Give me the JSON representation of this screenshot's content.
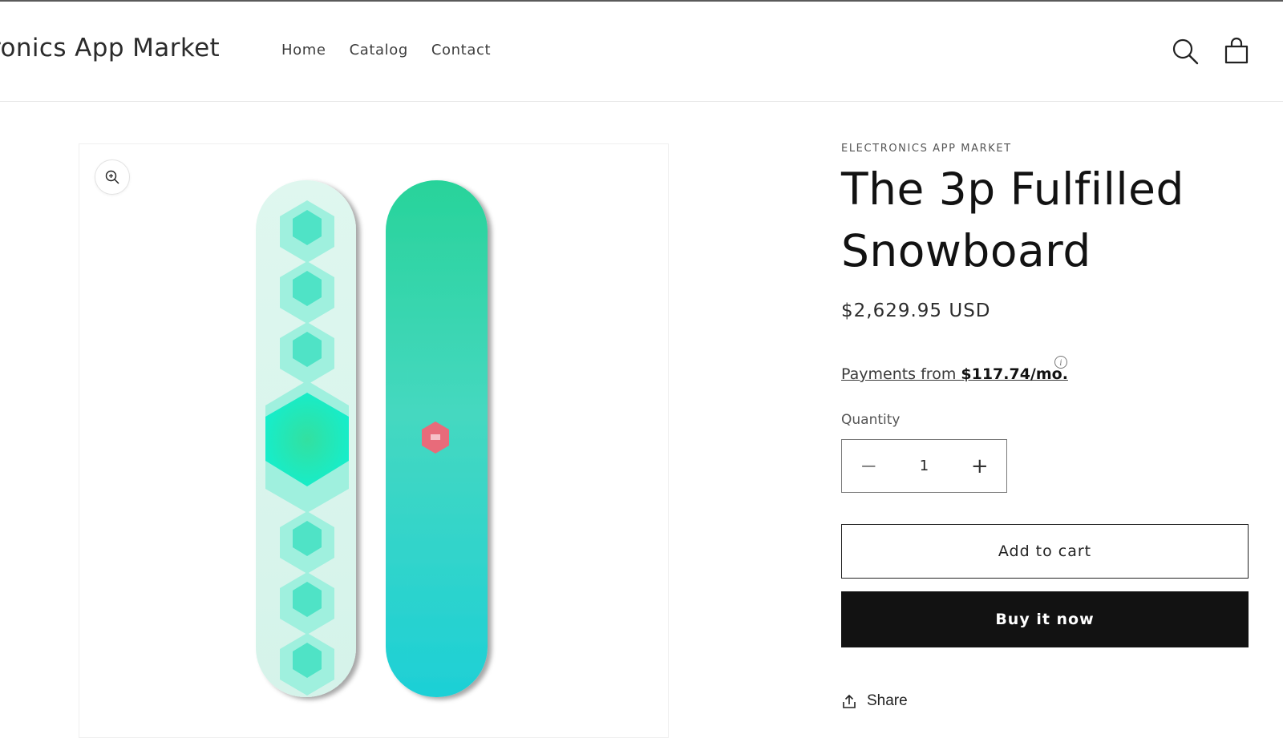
{
  "header": {
    "brand": "ctronics App Market",
    "nav": [
      "Home",
      "Catalog",
      "Contact"
    ],
    "icons": [
      "search-icon",
      "cart-icon"
    ]
  },
  "media": {
    "zoom_icon": "magnify-plus-icon",
    "colors": {
      "mint": "#dff7ef",
      "teal": "#2dd4b4",
      "aqua": "#1fd0d6",
      "accent": "#e86b7a"
    }
  },
  "product": {
    "vendor": "ELECTRONICS APP MARKET",
    "title_line1": "The 3p Fulfilled",
    "title_line2": "Snowboard",
    "price": "$2,629.95 USD",
    "payments_prefix": "Payments from ",
    "payments_amount": "$117.74/mo.",
    "quantity_label": "Quantity",
    "quantity_value": "1",
    "minus": "−",
    "plus": "+",
    "add_to_cart": "Add to cart",
    "buy_now": "Buy it now",
    "share": "Share"
  }
}
